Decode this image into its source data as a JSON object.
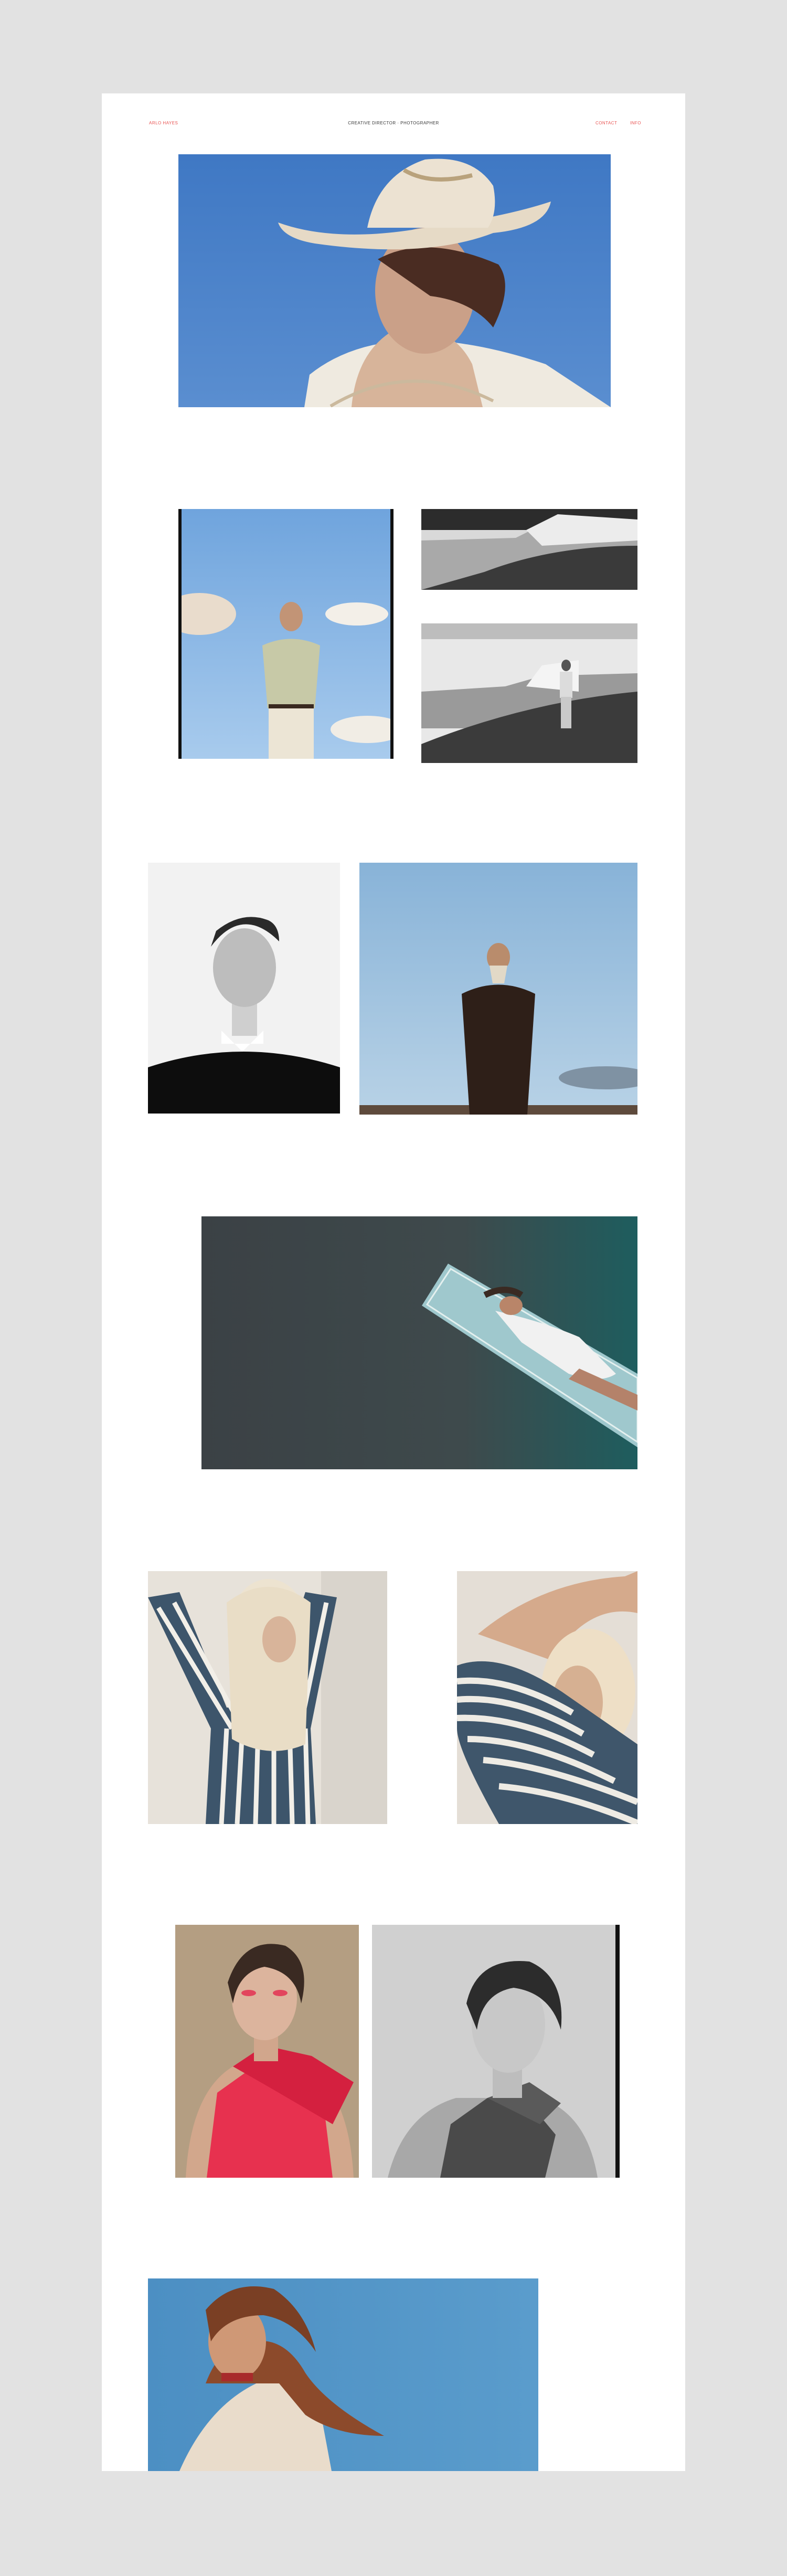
{
  "header": {
    "left_label": "Arlo Hayes",
    "center_label": "Creative Director · Photographer",
    "nav": [
      "Contact",
      "Info"
    ]
  },
  "photos": [
    {
      "name": "photo-cowboy-hat-portrait",
      "icon": "photo-icon"
    },
    {
      "name": "photo-man-sky",
      "icon": "photo-icon"
    },
    {
      "name": "photo-coastal-cliffs",
      "icon": "photo-icon"
    },
    {
      "name": "photo-man-on-cliffs",
      "icon": "photo-icon"
    },
    {
      "name": "photo-bw-portrait-man",
      "icon": "photo-icon"
    },
    {
      "name": "photo-man-sweater-sky",
      "icon": "photo-icon"
    },
    {
      "name": "photo-pool-lounger",
      "icon": "photo-icon"
    },
    {
      "name": "photo-striped-shirt-blonde",
      "icon": "photo-icon"
    },
    {
      "name": "photo-striped-shirt-closeup",
      "icon": "photo-icon"
    },
    {
      "name": "photo-red-bow-portrait",
      "icon": "photo-icon"
    },
    {
      "name": "photo-bw-bow-portrait",
      "icon": "photo-icon"
    },
    {
      "name": "photo-red-hair-fringe",
      "icon": "photo-icon"
    }
  ],
  "colors": {
    "page_background": "#e2e2e2",
    "sheet_background": "#ffffff",
    "accent": "#e8514f"
  }
}
